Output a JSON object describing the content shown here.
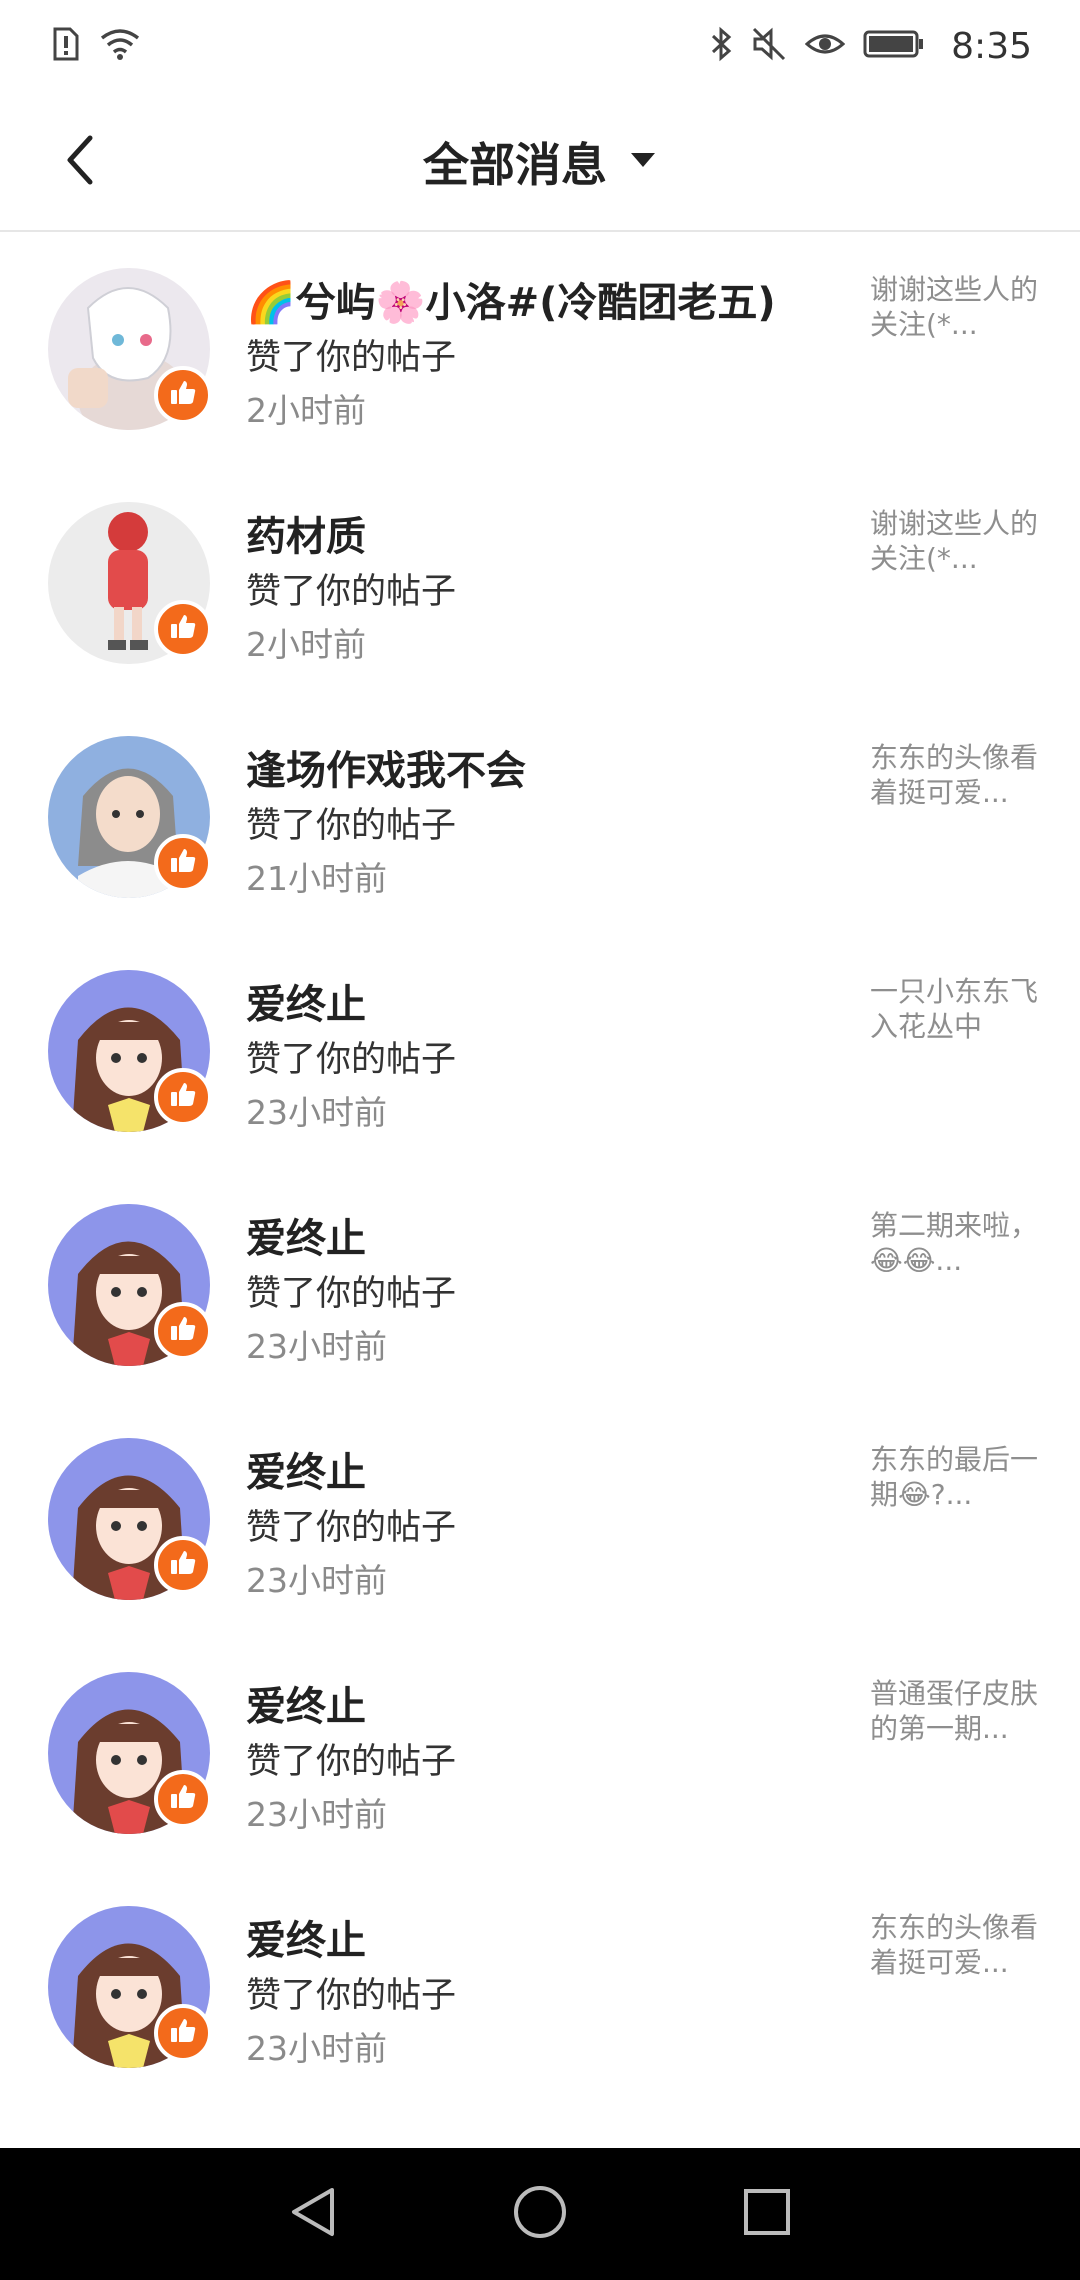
{
  "status_bar": {
    "time": "8:35",
    "left_icons": [
      "sim-alert-icon",
      "wifi-icon"
    ],
    "right_icons": [
      "bluetooth-icon",
      "mute-icon",
      "eye-icon",
      "battery-icon"
    ]
  },
  "header": {
    "title": "全部消息",
    "back_icon": "chevron-left-icon",
    "dropdown_icon": "caret-down-icon"
  },
  "colors": {
    "like_badge": "#f36a1b",
    "avatar_bg_purple": "#8d95ea",
    "nav_bar": "#000000"
  },
  "messages": [
    {
      "name": "🌈兮屿🌸小洛#(冷酷团老五)",
      "action": "赞了你的帖子",
      "time": "2小时前",
      "preview": "谢谢这些人的关注(*..."
    },
    {
      "name": "药材质",
      "action": "赞了你的帖子",
      "time": "2小时前",
      "preview": "谢谢这些人的关注(*..."
    },
    {
      "name": "逢场作戏我不会",
      "action": "赞了你的帖子",
      "time": "21小时前",
      "preview": "东东的头像看着挺可爱..."
    },
    {
      "name": "爱终止",
      "action": "赞了你的帖子",
      "time": "23小时前",
      "preview": "一只小东东飞入花丛中"
    },
    {
      "name": "爱终止",
      "action": "赞了你的帖子",
      "time": "23小时前",
      "preview": "第二期来啦，😂😂..."
    },
    {
      "name": "爱终止",
      "action": "赞了你的帖子",
      "time": "23小时前",
      "preview": "东东的最后一期😂?..."
    },
    {
      "name": "爱终止",
      "action": "赞了你的帖子",
      "time": "23小时前",
      "preview": "普通蛋仔皮肤的第一期..."
    },
    {
      "name": "爱终止",
      "action": "赞了你的帖子",
      "time": "23小时前",
      "preview": "东东的头像看着挺可爱..."
    }
  ],
  "nav_bar": {
    "buttons": [
      "back-triangle-icon",
      "home-circle-icon",
      "recents-square-icon"
    ]
  }
}
